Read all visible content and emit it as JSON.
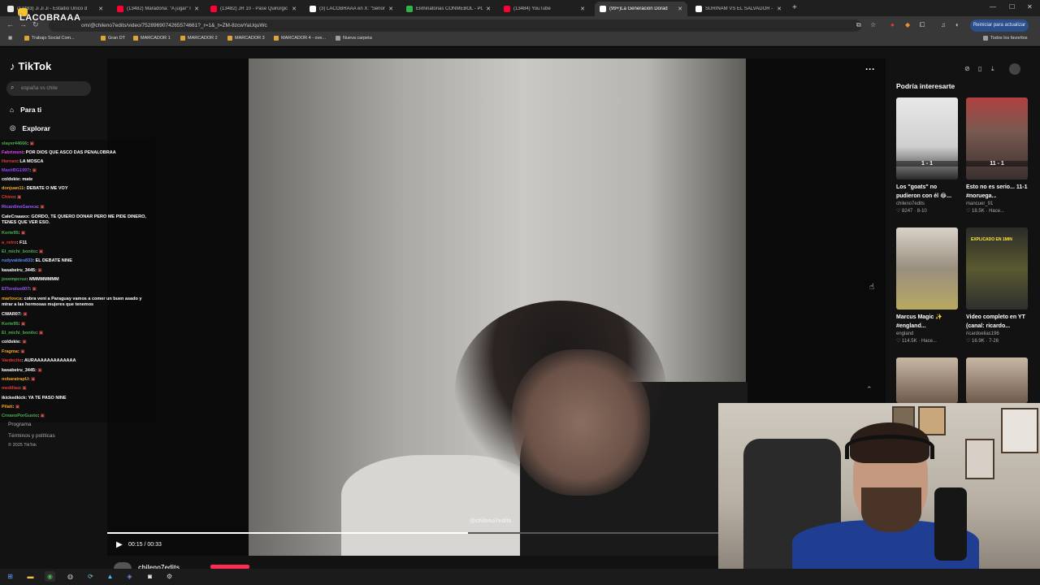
{
  "browser": {
    "tabs": [
      {
        "title": "(13483) Ji Ji Ji - Estadio Único d",
        "favicon_color": "#e8e8e8"
      },
      {
        "title": "(13482) Maradona: \"A jugar\" m",
        "favicon_color": "#ff0033"
      },
      {
        "title": "(13482) JR 10 - Pase Quirúrgic",
        "favicon_color": "#ff0033"
      },
      {
        "title": "(3) LACOBRAAA en X: \"Señores",
        "favicon_color": "#ffffff"
      },
      {
        "title": "Eliminatorias CONMEBOL - PC",
        "favicon_color": "#2fb34a"
      },
      {
        "title": "(13484) YouTube",
        "favicon_color": "#ff0033"
      },
      {
        "title": "(99+)La Generación Dorad",
        "favicon_color": "#ffffff",
        "active": true
      },
      {
        "title": "SURINAM VS EL SALVADOR - ",
        "favicon_color": "#ffffff"
      }
    ],
    "url": "om/@chileno7edits/video/7528969074265574661?_r=1&_t=ZM-8zcwYaUquWc",
    "restart_label": "Reiniciar para actualizar",
    "bookmarks": [
      "Trabajo Social Com...",
      "Gran DT",
      "MARCADOR 1",
      "MARCADOR 2",
      "MARCADOR 3",
      "MARCADOR 4 - ove...",
      "Nueva carpeta"
    ],
    "all_bookmarks": "Todos los favoritos"
  },
  "stream": {
    "logo": "LACOBRAAA",
    "chat": [
      {
        "user": "slayer44666",
        "msg": ":",
        "color": "#4caf50",
        "emote": true
      },
      {
        "user": "Fabrimeni",
        "msg": ": POR DIOS QUE ASCO DAS PENALOBRAA",
        "color": "#e040fb"
      },
      {
        "user": "Hernan",
        "msg": ": LA MOSCA",
        "color": "#e53935"
      },
      {
        "user": "MaxiiBG1997",
        "msg": ":",
        "color": "#8e44ff",
        "emote": true
      },
      {
        "user": "coldskie",
        "msg": ": mate",
        "color": "#ffffff"
      },
      {
        "user": "donjuan11",
        "msg": ": DEBATE O ME VOY",
        "color": "#f5a623"
      },
      {
        "user": "Chino",
        "msg": ": ",
        "color": "#e53935",
        "emote": true
      },
      {
        "user": "RicardinoGareca",
        "msg": ": ",
        "color": "#9b59ff",
        "emote": true
      },
      {
        "user": "CaleCraaaxx",
        "msg": ": GORDO, TE QUIERO DONAR PERO ME PIDE DINERO, TENES QUE VER ESO.",
        "color": "#ffffff"
      },
      {
        "user": "Korte95",
        "msg": ": ",
        "color": "#4caf50",
        "emote": true
      },
      {
        "user": "a_retro",
        "msg": ": F11",
        "color": "#e53935"
      },
      {
        "user": "El_michi_bonito",
        "msg": ":",
        "color": "#4caf50",
        "emote": true
      },
      {
        "user": "rudyvaldes833",
        "msg": ": EL DEBATE NINE",
        "color": "#5b8cff"
      },
      {
        "user": "kasabeiru_3445",
        "msg": ":",
        "color": "#ffffff",
        "emote": true
      },
      {
        "user": "josempcruz",
        "msg": ": MMMMMMMM",
        "color": "#4caf50"
      },
      {
        "user": "ElTorolos007",
        "msg": ":",
        "color": "#9b59ff",
        "emote": true
      },
      {
        "user": "marlovca",
        "msg": ": cobra veni a Paraguay vamos a comer un buen asado y mirar a las hermosas mujeres que tenemos",
        "color": "#f5a623"
      },
      {
        "user": "CWAR07",
        "msg": ":",
        "color": "#ffffff",
        "emote": true
      },
      {
        "user": "Korte95",
        "msg": ":",
        "color": "#4caf50",
        "emote": true
      },
      {
        "user": "El_michi_bonito",
        "msg": ":",
        "color": "#4caf50",
        "emote": true
      },
      {
        "user": "coldskie",
        "msg": ":",
        "color": "#ffffff",
        "emote": true
      },
      {
        "user": "Fragma",
        "msg": ":",
        "color": "#f5a623",
        "emote": true
      },
      {
        "user": "Vardecito",
        "msg": ": AURAAAAAAAAAAAAA",
        "color": "#e53935"
      },
      {
        "user": "kasabeiru_3445",
        "msg": ":",
        "color": "#ffffff",
        "emote": true
      },
      {
        "user": "nobaratrapU",
        "msg": ":",
        "color": "#f5a623",
        "emote": true
      },
      {
        "user": "medillas",
        "msg": ":",
        "color": "#e53935",
        "emote": true
      },
      {
        "user": "ikickedkick",
        "msg": ": YA TE PASO NINE",
        "color": "#ffffff"
      },
      {
        "user": "Pilatt",
        "msg": ":",
        "color": "#f5a623",
        "emote": true
      },
      {
        "user": "CrnanoPorGusto",
        "msg": ":",
        "color": "#4caf50",
        "emote": true
      }
    ]
  },
  "tiktok": {
    "logo": "TikTok",
    "search_placeholder": "españa vs chile",
    "nav": [
      {
        "label": "Para ti",
        "icon": "home-icon"
      },
      {
        "label": "Explorar",
        "icon": "compass-icon"
      }
    ],
    "footer": [
      "Programa",
      "Términos y políticas",
      "© 2025 TikTok"
    ],
    "video": {
      "time": "00:15 / 00:33",
      "progress": 0.59,
      "author": "chileno7edits",
      "watermark": "@chileno7edits"
    },
    "suggestions_title": "Podría interesarte",
    "suggestions": [
      {
        "title": "Los \"goats\" no pudieron con él 😂...",
        "author": "chileno7edits",
        "likes": "8247",
        "age": "8-10",
        "score": "1 - 1"
      },
      {
        "title": "Esto no es serio... 11-1 #noruega...",
        "author": "mancuer_91",
        "likes": "18.5K",
        "age": "Hace...",
        "score": "11 - 1"
      },
      {
        "title": "Marcus Magic ✨ #england...",
        "author": "england",
        "likes": "114.5K",
        "age": "Hace..."
      },
      {
        "title": "Video completo en YT (canal: ricardo...",
        "author": "ricardoelias196",
        "likes": "16.9K",
        "age": "7-26",
        "thumb_caption": "EXPLICADO EN 1MIN"
      }
    ]
  }
}
